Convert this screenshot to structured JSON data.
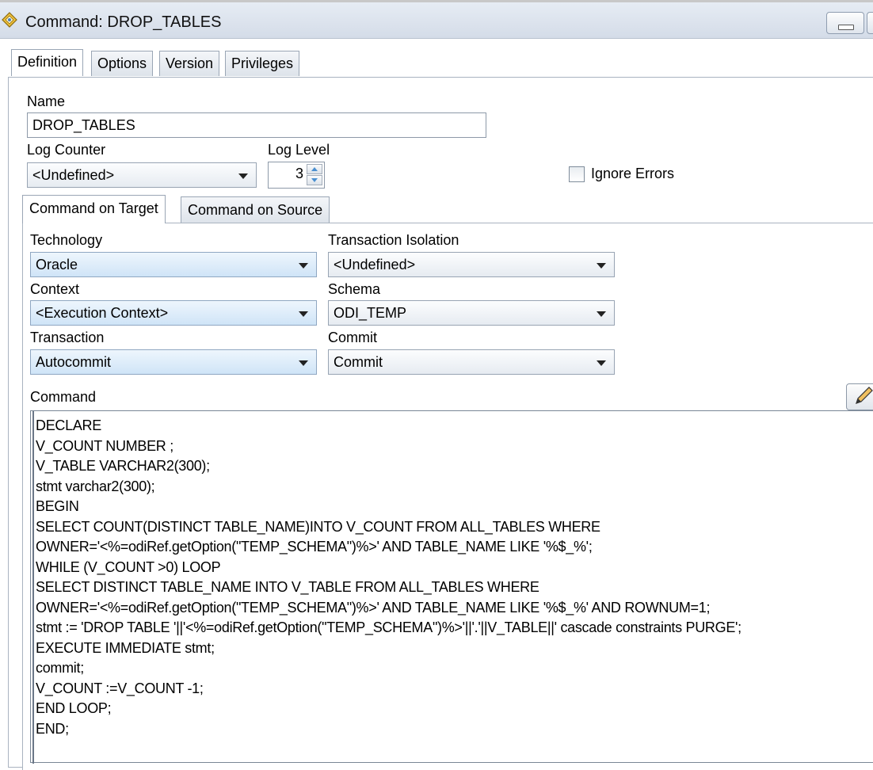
{
  "window": {
    "title": "Command: DROP_TABLES"
  },
  "tabs": [
    {
      "label": "Definition"
    },
    {
      "label": "Options"
    },
    {
      "label": "Version"
    },
    {
      "label": "Privileges"
    }
  ],
  "definition": {
    "name_label": "Name",
    "name_value": "DROP_TABLES",
    "log_counter_label": "Log Counter",
    "log_counter_value": "<Undefined>",
    "log_level_label": "Log Level",
    "log_level_value": "3",
    "ignore_errors_label": "Ignore Errors",
    "ignore_errors_checked": false
  },
  "subtabs": [
    {
      "label": "Command on Target"
    },
    {
      "label": "Command on Source"
    }
  ],
  "target": {
    "technology_label": "Technology",
    "technology_value": "Oracle",
    "transaction_isolation_label": "Transaction Isolation",
    "transaction_isolation_value": "<Undefined>",
    "context_label": "Context",
    "context_value": "<Execution Context>",
    "schema_label": "Schema",
    "schema_value": "ODI_TEMP",
    "transaction_label": "Transaction",
    "transaction_value": "Autocommit",
    "commit_label": "Commit",
    "commit_value": "Commit",
    "command_label": "Command"
  },
  "command_lines": [
    "DECLARE",
    "V_COUNT NUMBER ;",
    "V_TABLE VARCHAR2(300);",
    "stmt varchar2(300);",
    "BEGIN",
    "SELECT COUNT(DISTINCT TABLE_NAME)INTO V_COUNT FROM ALL_TABLES WHERE",
    "OWNER='<%=odiRef.getOption(\"TEMP_SCHEMA\")%>' AND TABLE_NAME LIKE '%$_%';",
    "WHILE (V_COUNT >0) LOOP",
    "SELECT DISTINCT TABLE_NAME INTO V_TABLE FROM ALL_TABLES WHERE",
    "OWNER='<%=odiRef.getOption(\"TEMP_SCHEMA\")%>' AND TABLE_NAME LIKE '%$_%' AND ROWNUM=1;",
    "stmt := 'DROP TABLE '||'<%=odiRef.getOption(\"TEMP_SCHEMA\")%>'||'.'||V_TABLE||' cascade constraints PURGE';",
    "EXECUTE IMMEDIATE stmt;",
    "commit;",
    "V_COUNT :=V_COUNT -1;",
    "END LOOP;",
    "END;"
  ]
}
